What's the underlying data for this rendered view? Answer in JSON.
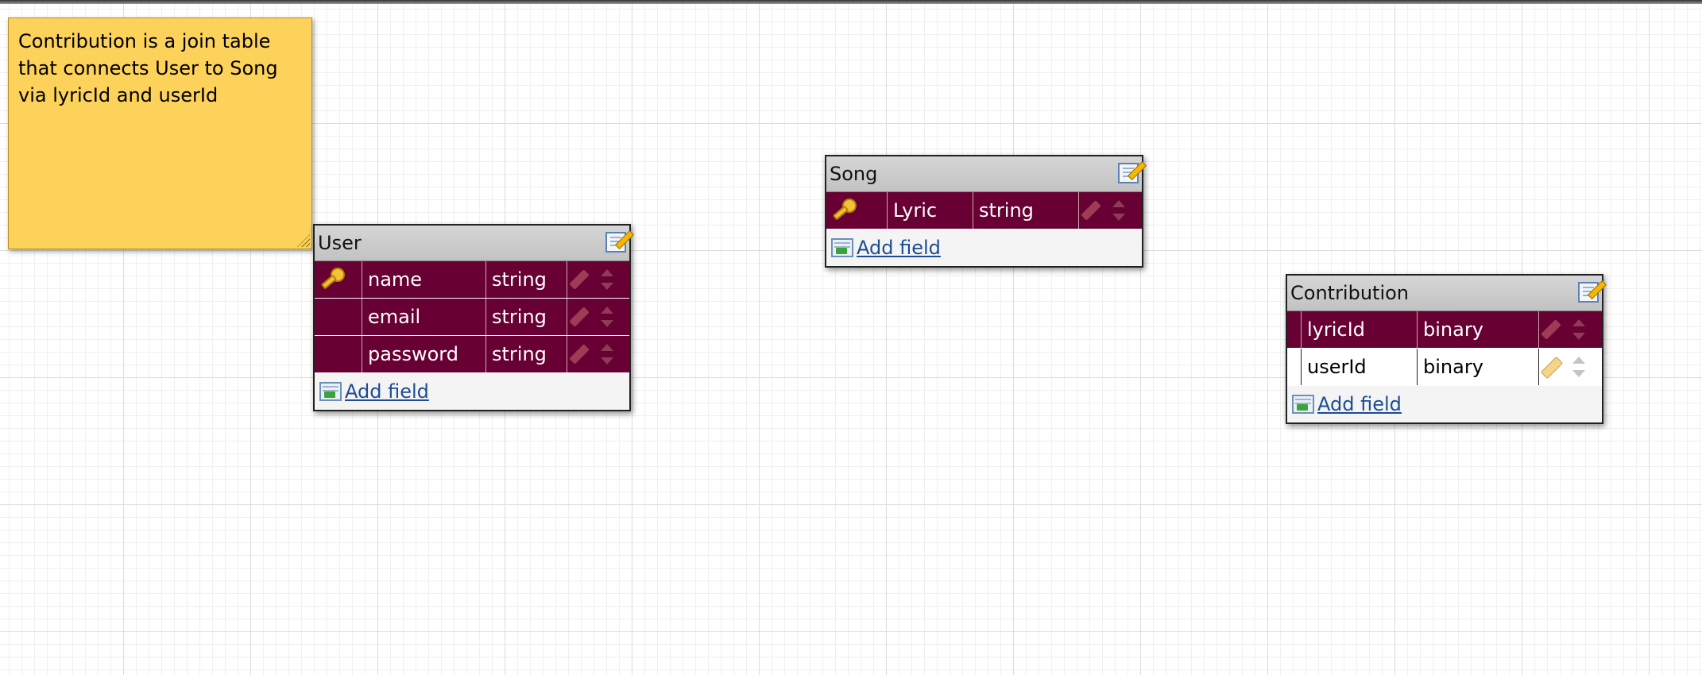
{
  "note": {
    "text": "Contribution is a join table that connects User to Song via lyricId and userId"
  },
  "tables": {
    "user": {
      "title": "User",
      "fields": [
        {
          "name": "name",
          "type": "string",
          "primary_key": true
        },
        {
          "name": "email",
          "type": "string",
          "primary_key": false
        },
        {
          "name": "password",
          "type": "string",
          "primary_key": false
        }
      ],
      "add_field_label": "Add field"
    },
    "song": {
      "title": "Song",
      "fields": [
        {
          "name": "Lyric",
          "type": "string",
          "primary_key": true
        }
      ],
      "add_field_label": "Add field"
    },
    "contribution": {
      "title": "Contribution",
      "fields": [
        {
          "name": "lyricId",
          "type": "binary",
          "primary_key": false
        },
        {
          "name": "userId",
          "type": "binary",
          "primary_key": false
        }
      ],
      "add_field_label": "Add field"
    }
  },
  "colors": {
    "field_row": "#680033",
    "note": "#fcd25a",
    "link": "#1c4c94"
  }
}
